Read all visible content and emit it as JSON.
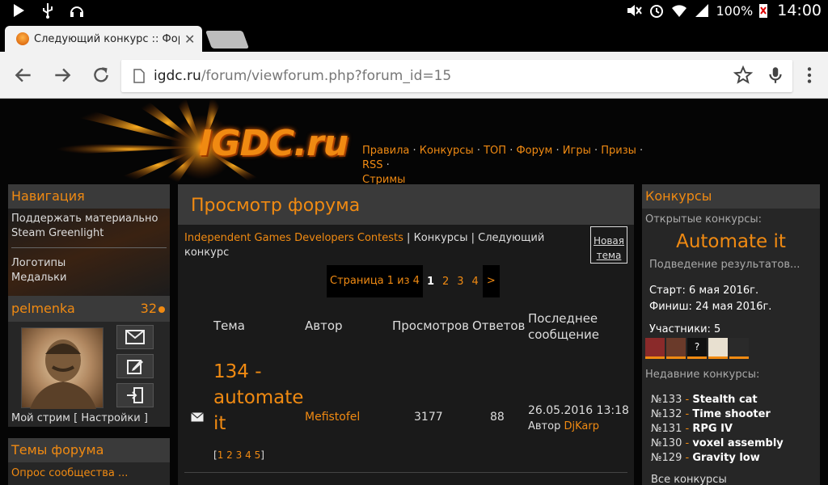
{
  "statusbar": {
    "battery": "100%",
    "time": "14:00"
  },
  "tab": {
    "title": "Следующий конкурс :: Форум",
    "close": "✕"
  },
  "omnibox": {
    "host": "igdc.ru",
    "path": "/forum/viewforum.php?forum_id=15"
  },
  "banner": {
    "logo": "IGDC.ru",
    "nav": [
      "Правила",
      "Конкурсы",
      "ТОП",
      "Форум",
      "Игры",
      "Призы",
      "RSS",
      "Стримы"
    ]
  },
  "left": {
    "nav_title": "Навигация",
    "nav_items": [
      "Поддержать материально",
      "Steam Greenlight",
      "Логотипы",
      "Медальки"
    ],
    "username": "pelmenka",
    "points": "32",
    "my_stream": "Мой стрим",
    "settings": "Настройки",
    "themes_title": "Темы форума",
    "themes_first": "Опрос сообщества ..."
  },
  "center": {
    "title": "Просмотр форума",
    "breadcrumb_link": "Independent Games Developers Contests",
    "breadcrumb_rest": "Конкурсы | Следующий конкурс",
    "new_topic": "Новая тема",
    "pager_label": "Страница 1 из 4",
    "pages": [
      "1",
      "2",
      "3",
      "4"
    ],
    "pager_next": ">",
    "headers": {
      "topic": "Тема",
      "author": "Автор",
      "views": "Просмотров",
      "replies": "Ответов",
      "last": "Последнее сообщение"
    },
    "topic": {
      "title": "134 - automate it",
      "pages": [
        "1",
        "2",
        "3",
        "4",
        "5"
      ],
      "author": "Mefistofel",
      "views": "3177",
      "replies": "88",
      "last_date": "26.05.2016 13:18",
      "last_by_label": "Автор",
      "last_by": "DjKarp"
    }
  },
  "right": {
    "title": "Конкурсы",
    "open_label": "Открытые конкурсы:",
    "contest": "Automate it",
    "status": "Подведение результатов...",
    "start": "Старт: 6 мая 2016г.",
    "finish": "Финиш: 24 мая 2016г.",
    "participants": "Участники: 5",
    "recent_label": "Недавние конкурсы:",
    "recent": [
      {
        "num": "№133",
        "name": "Stealth cat"
      },
      {
        "num": "№132",
        "name": "Time shooter"
      },
      {
        "num": "№131",
        "name": "RPG IV"
      },
      {
        "num": "№130",
        "name": "voxel assembly"
      },
      {
        "num": "№129",
        "name": "Gravity low"
      }
    ],
    "all": "Все конкурсы"
  },
  "colors": {
    "accent": "#f08a12",
    "panel": "#3a3a3a",
    "body": "#262626"
  }
}
